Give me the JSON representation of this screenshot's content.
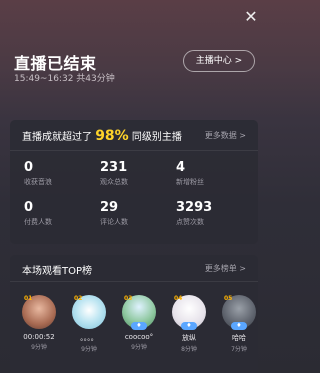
{
  "header": {
    "title": "直播已结束",
    "time_range": "15:49~16:32 共43分钟",
    "center_button": "主播中心 >",
    "close_icon": "close-icon"
  },
  "summary": {
    "lead_text_1": "直播成就超过了",
    "percent": "98%",
    "lead_text_2": "同级别主播",
    "more_label": "更多数据 >",
    "stats": [
      {
        "value": "0",
        "label": "收获音浪"
      },
      {
        "value": "231",
        "label": "观众总数"
      },
      {
        "value": "4",
        "label": "新增粉丝"
      },
      {
        "value": "0",
        "label": "付费人数"
      },
      {
        "value": "29",
        "label": "评论人数"
      },
      {
        "value": "3293",
        "label": "点赞次数"
      }
    ]
  },
  "ranking": {
    "title": "本场观看TOP榜",
    "more_label": "更多榜单 >",
    "items": [
      {
        "rank": "01",
        "name": "00:00:52",
        "time": "9分钟",
        "color": "#c07f62"
      },
      {
        "rank": "02",
        "name": "。。。。",
        "time": "9分钟",
        "color": "#9bd3e8"
      },
      {
        "rank": "03",
        "name": "coocoo°",
        "time": "9分钟",
        "color": "#7fc48a"
      },
      {
        "rank": "04",
        "name": "放纵",
        "time": "8分钟",
        "color": "#f0eef2"
      },
      {
        "rank": "05",
        "name": "哈哈",
        "time": "7分钟",
        "color": "#6a6e78"
      }
    ]
  }
}
